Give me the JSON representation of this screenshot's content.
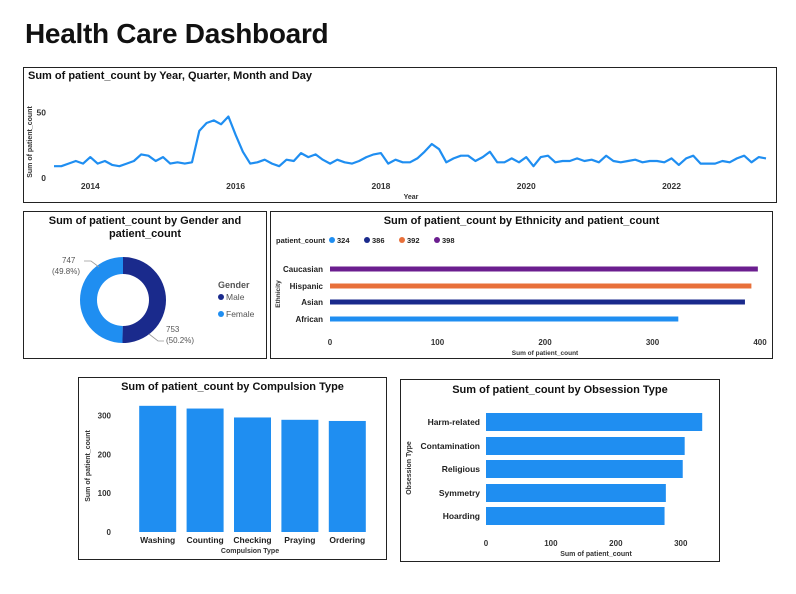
{
  "dashboard": {
    "title": "Health Care Dashboard"
  },
  "colors": {
    "primary": "#1F8EF1",
    "navy": "#1A2A8C",
    "orange": "#E8703A",
    "purple": "#6B1E8F"
  },
  "chart_data": [
    {
      "id": "trend",
      "type": "line",
      "title": "Sum of patient_count by Year, Quarter, Month and Day",
      "xlabel": "Year",
      "ylabel": "Sum of patient_count",
      "x_ticks": [
        "2014",
        "2016",
        "2018",
        "2020",
        "2022"
      ],
      "y_ticks": [
        0,
        50
      ],
      "xlim": [
        2013.5,
        2023.3
      ],
      "ylim": [
        0,
        55
      ],
      "x": [
        2013.5,
        2013.6,
        2013.7,
        2013.8,
        2013.9,
        2014.0,
        2014.1,
        2014.2,
        2014.3,
        2014.4,
        2014.5,
        2014.6,
        2014.7,
        2014.8,
        2014.9,
        2015.0,
        2015.1,
        2015.2,
        2015.3,
        2015.4,
        2015.5,
        2015.6,
        2015.7,
        2015.8,
        2015.9,
        2016.0,
        2016.1,
        2016.2,
        2016.3,
        2016.4,
        2016.5,
        2016.6,
        2016.7,
        2016.8,
        2016.9,
        2017.0,
        2017.1,
        2017.2,
        2017.3,
        2017.4,
        2017.5,
        2017.6,
        2017.7,
        2017.8,
        2017.9,
        2018.0,
        2018.1,
        2018.2,
        2018.3,
        2018.4,
        2018.5,
        2018.6,
        2018.7,
        2018.8,
        2018.9,
        2019.0,
        2019.1,
        2019.2,
        2019.3,
        2019.4,
        2019.5,
        2019.6,
        2019.7,
        2019.8,
        2019.9,
        2020.0,
        2020.1,
        2020.2,
        2020.3,
        2020.4,
        2020.5,
        2020.6,
        2020.7,
        2020.8,
        2020.9,
        2021.0,
        2021.1,
        2021.2,
        2021.3,
        2021.4,
        2021.5,
        2021.6,
        2021.7,
        2021.8,
        2021.9,
        2022.0,
        2022.1,
        2022.2,
        2022.3,
        2022.4,
        2022.5,
        2022.6,
        2022.7,
        2022.8,
        2022.9,
        2023.0,
        2023.1,
        2023.2,
        2023.3
      ],
      "values": [
        9,
        9,
        11,
        13,
        11,
        16,
        11,
        13,
        10,
        9,
        11,
        13,
        18,
        17,
        13,
        16,
        11,
        12,
        11,
        12,
        36,
        42,
        44,
        41,
        47,
        33,
        20,
        11,
        12,
        14,
        11,
        9,
        14,
        13,
        19,
        16,
        18,
        14,
        11,
        14,
        12,
        11,
        13,
        16,
        18,
        19,
        11,
        14,
        12,
        12,
        15,
        20,
        26,
        22,
        12,
        15,
        17,
        17,
        13,
        16,
        20,
        12,
        12,
        15,
        12,
        16,
        9,
        16,
        17,
        12,
        13,
        13,
        15,
        13,
        14,
        12,
        17,
        13,
        12,
        13,
        14,
        12,
        13,
        13,
        12,
        15,
        10,
        15,
        17,
        11,
        11,
        11,
        13,
        12,
        15,
        17,
        12,
        16,
        15,
        12,
        11,
        15,
        15,
        13,
        11,
        8,
        12,
        12,
        14,
        12,
        13,
        14,
        15,
        13,
        12,
        12,
        13,
        13,
        15,
        14,
        10,
        4
      ]
    },
    {
      "id": "gender",
      "type": "pie",
      "title": "Sum of patient_count by Gender and patient_count",
      "legend_title": "Gender",
      "categories": [
        "Male",
        "Female"
      ],
      "values": [
        753,
        747
      ],
      "data_labels": [
        {
          "value": "753",
          "pct": "(50.2%)"
        },
        {
          "value": "747",
          "pct": "(49.8%)"
        }
      ]
    },
    {
      "id": "ethnicity",
      "type": "bar",
      "orientation": "horizontal",
      "title": "Sum of patient_count by Ethnicity and patient_count",
      "legend_title": "patient_count",
      "legend": [
        "324",
        "386",
        "392",
        "398"
      ],
      "categories": [
        "Caucasian",
        "Hispanic",
        "Asian",
        "African"
      ],
      "values": [
        398,
        392,
        386,
        324
      ],
      "xlabel": "Sum of patient_count",
      "ylabel": "Ethnicity",
      "x_ticks": [
        0,
        100,
        200,
        300,
        400
      ],
      "xlim": [
        0,
        400
      ]
    },
    {
      "id": "compulsion",
      "type": "bar",
      "title": "Sum of patient_count by Compulsion Type",
      "categories": [
        "Washing",
        "Counting",
        "Checking",
        "Praying",
        "Ordering"
      ],
      "values": [
        325,
        318,
        295,
        289,
        286
      ],
      "xlabel": "Compulsion Type",
      "ylabel": "Sum of patient_count",
      "y_ticks": [
        0,
        100,
        200,
        300
      ],
      "ylim": [
        0,
        340
      ]
    },
    {
      "id": "obsession",
      "type": "bar",
      "orientation": "horizontal",
      "title": "Sum of patient_count by Obsession Type",
      "categories": [
        "Harm-related",
        "Contamination",
        "Religious",
        "Symmetry",
        "Hoarding"
      ],
      "values": [
        333,
        306,
        303,
        277,
        275
      ],
      "xlabel": "Sum of patient_count",
      "ylabel": "Obsession Type",
      "x_ticks": [
        0,
        100,
        200,
        300
      ],
      "xlim": [
        0,
        345
      ]
    }
  ]
}
